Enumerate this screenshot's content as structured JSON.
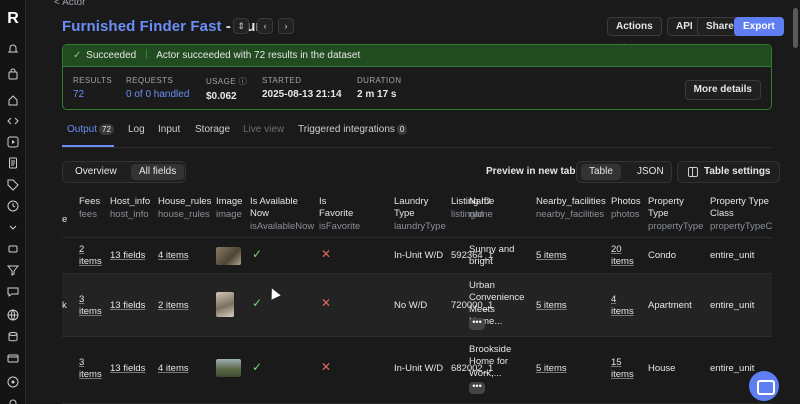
{
  "breadcrumb": "< Actor",
  "run": {
    "name": "Furnished Finder Fast",
    "suffix": "Run"
  },
  "header_buttons": {
    "actions": "Actions",
    "api": "API",
    "share": "Share",
    "export": "Export"
  },
  "status": {
    "state": "Succeeded",
    "message": "Actor succeeded with 72 results in the dataset"
  },
  "stats": [
    {
      "label": "RESULTS",
      "value": "72"
    },
    {
      "label": "REQUESTS",
      "value": "0 of 0 handled"
    },
    {
      "label": "USAGE",
      "value": "$0.062"
    },
    {
      "label": "STARTED",
      "value": "2025-08-13 21:14"
    },
    {
      "label": "DURATION",
      "value": "2 m 17 s"
    }
  ],
  "more_details": "More details",
  "tabs": {
    "output": "Output",
    "output_count": "72",
    "log": "Log",
    "input": "Input",
    "storage": "Storage",
    "live": "Live view",
    "integrations": "Triggered integrations",
    "integrations_count": "0"
  },
  "views": {
    "overview": "Overview",
    "all_fields": "All fields"
  },
  "preview_label": "Preview in new tab",
  "formats": {
    "table": "Table",
    "json": "JSON"
  },
  "table_settings": "Table settings",
  "columns": [
    {
      "title": "Fees",
      "key": "fees"
    },
    {
      "title": "Host_info",
      "key": "host_info"
    },
    {
      "title": "House_rules",
      "key": "house_rules"
    },
    {
      "title": "Image",
      "key": "image"
    },
    {
      "title": "Is Available Now",
      "key": "isAvailableNow"
    },
    {
      "title": "Is Favorite",
      "key": "isFavorite"
    },
    {
      "title": "Laundry Type",
      "key": "laundryType"
    },
    {
      "title": "Listing ID",
      "key": "listingId"
    },
    {
      "title": "Name",
      "key": "name"
    },
    {
      "title": "Nearby_facilities",
      "key": "nearby_facilities"
    },
    {
      "title": "Photos",
      "key": "photos"
    },
    {
      "title": "Property Type",
      "key": "propertyType"
    },
    {
      "title": "Property Type Class",
      "key": "propertyTypeCla"
    }
  ],
  "partial_left": {
    "row2": "k",
    "head": "e"
  },
  "rows": [
    {
      "fees": "2 items",
      "host": "13 fields",
      "rules": "4 items",
      "laundry": "In-Unit W/D",
      "listing": "592364_1",
      "name": "Sunny and bright",
      "nearby": "5 items",
      "photos": "20 items",
      "ptype": "Condo",
      "pclass": "entire_unit"
    },
    {
      "fees": "3 items",
      "host": "13 fields",
      "rules": "2 items",
      "laundry": "No W/D",
      "listing": "720000_1",
      "name": "Urban Convenience Meets Home...",
      "nearby": "5 items",
      "photos": "4 items",
      "ptype": "Apartment",
      "pclass": "entire_unit"
    },
    {
      "fees": "3 items",
      "host": "13 fields",
      "rules": "4 items",
      "laundry": "In-Unit W/D",
      "listing": "682002_1",
      "name": "Brookside Home for Work,...",
      "nearby": "5 items",
      "photos": "15 items",
      "ptype": "House",
      "pclass": "entire_unit"
    }
  ],
  "icons": {
    "check": "✓",
    "cross": "✕",
    "more": "•••",
    "chevron_down": "⌄"
  },
  "colors": {
    "accent": "#6b8ef8",
    "success": "#7fd47a",
    "error": "#e06a5d"
  }
}
